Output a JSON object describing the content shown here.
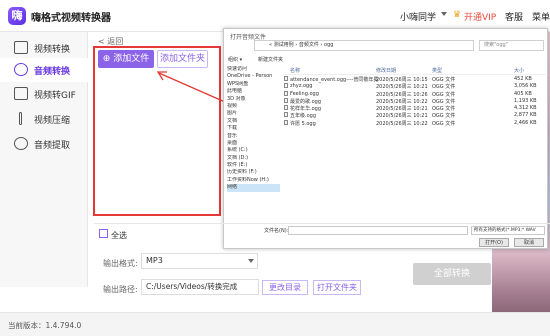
{
  "app": {
    "title": "嗨格式视频转换器",
    "logo_char": "嗨",
    "user": "小嗨同学",
    "vip": "开通VIP",
    "service": "客服",
    "menu": "菜单"
  },
  "sidebar": {
    "items": [
      {
        "label": "视频转换",
        "icon": "video-convert-icon",
        "active": false
      },
      {
        "label": "音频转换",
        "icon": "audio-convert-icon",
        "active": true
      },
      {
        "label": "视频转GIF",
        "icon": "gif-icon",
        "active": false
      },
      {
        "label": "视频压缩",
        "icon": "compress-icon",
        "active": false
      },
      {
        "label": "音频提取",
        "icon": "audio-extract-icon",
        "active": false
      }
    ]
  },
  "main": {
    "back": "< 返回",
    "add_file": "⊕ 添加文件",
    "add_folder": "添加文件夹",
    "select_all": "全选",
    "format_label": "输出格式:",
    "format_value": "MP3",
    "path_label": "输出路径:",
    "path_value": "C:/Users/Videos/转换完成",
    "change_dir": "更改目录",
    "open_folder": "打开文件夹",
    "convert_all": "全部转换",
    "version": "当前版本：1.4.794.0"
  },
  "dialog": {
    "title": "打开音频文件",
    "address": "« 测试用例 › 音频文件 › ogg",
    "search": "搜索\"ogg\"",
    "organize": "组织 ▾",
    "new_folder": "新建文件夹",
    "tree": [
      "快速访问",
      "OneDrive - Person",
      "WPS网盘",
      "此电脑",
      "3D 对象",
      "视频",
      "图片",
      "文档",
      "下载",
      "音乐",
      "桌面",
      "系统 (C:)",
      "文档 (D:)",
      "软件 (E:)",
      "历史资料 (F:)",
      "工作资料Now (H:)",
      "网络"
    ],
    "columns": [
      "名称",
      "修改日期",
      "类型",
      "大小"
    ],
    "files": [
      {
        "name": "attendance_event.ogg----普同敬年冕",
        "date": "2020/5/26周三 10:15",
        "type": "OGG 文件",
        "size": "452 KB"
      },
      {
        "name": "zhyz.ogg",
        "date": "2020/5/26周三 10:21",
        "type": "OGG 文件",
        "size": "3,056 KB"
      },
      {
        "name": "Feeling.ogg",
        "date": "2020/5/26周三 10:26",
        "type": "OGG 文件",
        "size": "405 KB"
      },
      {
        "name": "最爱的歌.ogg",
        "date": "2020/5/26周三 10:22",
        "type": "OGG 文件",
        "size": "1,193 KB"
      },
      {
        "name": "花样年华.ogg",
        "date": "2020/5/26周三 10:21",
        "type": "OGG 文件",
        "size": "4,312 KB"
      },
      {
        "name": "五年级.ogg",
        "date": "2020/5/26周三 10:21",
        "type": "OGG 文件",
        "size": "2,877 KB"
      },
      {
        "name": "许愿 5.ogg",
        "date": "2020/5/26周三 10:22",
        "type": "OGG 文件",
        "size": "2,466 KB"
      }
    ],
    "filename_label": "文件名(N):",
    "filter": "所有支持的格式(*.MP3;*.WAV",
    "open": "打开(O)",
    "cancel": "取消"
  },
  "colors": {
    "accent": "#8a63e8",
    "highlight": "#e53935"
  }
}
